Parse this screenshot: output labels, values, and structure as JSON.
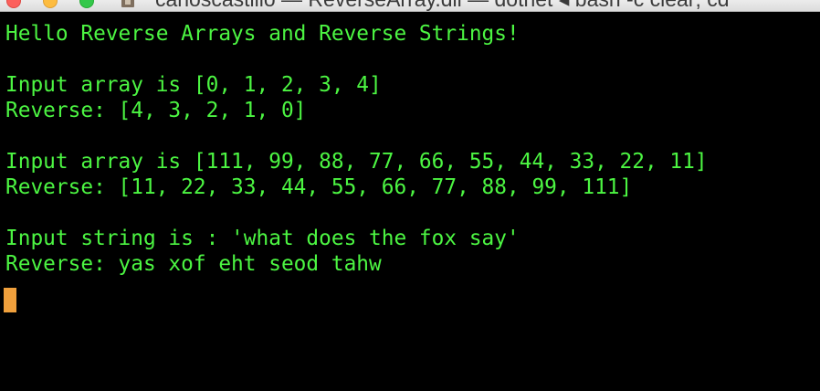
{
  "window": {
    "title": "carloscastillo — ReverseArray.dll — dotnet ◂ bash -c clear; cd"
  },
  "terminal": {
    "lines": [
      "Hello Reverse Arrays and Reverse Strings!",
      "",
      "Input array is [0, 1, 2, 3, 4]",
      "Reverse: [4, 3, 2, 1, 0]",
      "",
      "Input array is [111, 99, 88, 77, 66, 55, 44, 33, 22, 11]",
      "Reverse: [11, 22, 33, 44, 55, 66, 77, 88, 99, 111]",
      "",
      "Input string is : 'what does the fox say'",
      "Reverse: yas xof eht seod tahw"
    ],
    "text_color": "#4cf542",
    "background_color": "#000000",
    "cursor_color": "#f0a03c"
  }
}
